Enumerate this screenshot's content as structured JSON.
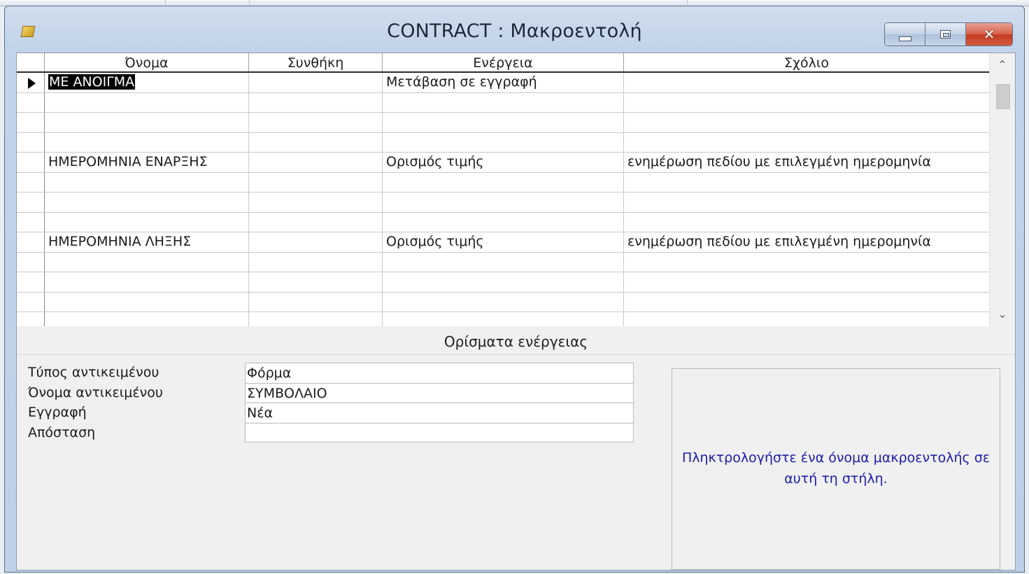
{
  "window": {
    "title": "CONTRACT : Μακροεντολή",
    "close_symbol": "✕"
  },
  "grid": {
    "columns": [
      "Όνομα",
      "Συνθήκη",
      "Ενέργεια",
      "Σχόλιο"
    ],
    "rows": [
      {
        "name": "ΜΕ ΑΝΟΙΓΜΑ",
        "condition": "",
        "action": "Μετάβαση σε εγγραφή",
        "comment": ""
      },
      {
        "name": "",
        "condition": "",
        "action": "",
        "comment": ""
      },
      {
        "name": "",
        "condition": "",
        "action": "",
        "comment": ""
      },
      {
        "name": "",
        "condition": "",
        "action": "",
        "comment": ""
      },
      {
        "name": "ΗΜΕΡΟΜΗΝΙΑ ΕΝΑΡΞΗΣ",
        "condition": "",
        "action": "Ορισμός τιμής",
        "comment": "ενημέρωση πεδίου με επιλεγμένη ημερομηνία"
      },
      {
        "name": "",
        "condition": "",
        "action": "",
        "comment": ""
      },
      {
        "name": "",
        "condition": "",
        "action": "",
        "comment": ""
      },
      {
        "name": "",
        "condition": "",
        "action": "",
        "comment": ""
      },
      {
        "name": "ΗΜΕΡΟΜΗΝΙΑ ΛΗΞΗΣ",
        "condition": "",
        "action": "Ορισμός τιμής",
        "comment": "ενημέρωση πεδίου με επιλεγμένη ημερομηνία"
      },
      {
        "name": "",
        "condition": "",
        "action": "",
        "comment": ""
      },
      {
        "name": "",
        "condition": "",
        "action": "",
        "comment": ""
      },
      {
        "name": "",
        "condition": "",
        "action": "",
        "comment": ""
      },
      {
        "name": "",
        "condition": "",
        "action": "",
        "comment": ""
      }
    ],
    "scroll_up": "⌃",
    "scroll_down": "⌄"
  },
  "arguments": {
    "title": "Ορίσματα ενέργειας",
    "items": [
      {
        "label": "Τύπος αντικειμένου",
        "value": "Φόρμα"
      },
      {
        "label": "Όνομα αντικειμένου",
        "value": "ΣΥΜΒΟΛΑΙΟ"
      },
      {
        "label": "Εγγραφή",
        "value": "Νέα"
      },
      {
        "label": "Απόσταση",
        "value": ""
      }
    ]
  },
  "help": {
    "text": "Πληκτρολογήστε ένα όνομα μακροεντολής σε αυτή τη στήλη."
  }
}
